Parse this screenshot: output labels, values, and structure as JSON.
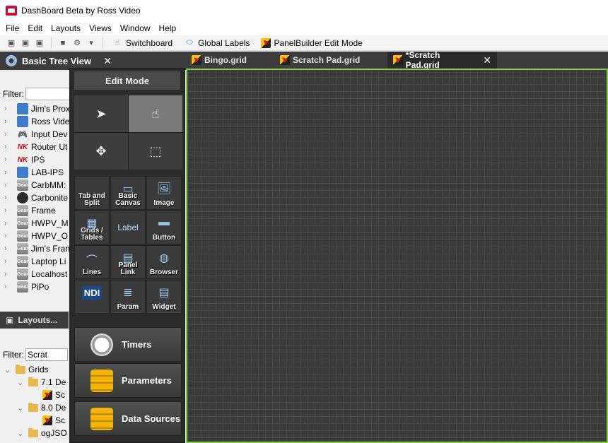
{
  "window": {
    "title": "DashBoard Beta by Ross Video"
  },
  "menu": [
    "File",
    "Edit",
    "Layouts",
    "Views",
    "Window",
    "Help"
  ],
  "toolbar": {
    "switchboard": "Switchboard",
    "global_labels": "Global Labels",
    "panelbuilder": "PanelBuilder Edit Mode"
  },
  "tree_panel": {
    "title": "Basic Tree View",
    "filter_label": "Filter:",
    "filter_value": "",
    "items": [
      {
        "label": "Jim's Prox",
        "icon": "network-icon"
      },
      {
        "label": "Ross Vide",
        "icon": "ross-icon"
      },
      {
        "label": "Input Dev",
        "icon": "gamepad-icon"
      },
      {
        "label": "Router Ut",
        "icon": "nk-icon"
      },
      {
        "label": "IPS",
        "icon": "nk-icon"
      },
      {
        "label": "LAB-IPS",
        "icon": "device-icon"
      },
      {
        "label": "CarbMM:",
        "icon": "gear-icon"
      },
      {
        "label": "Carbonite",
        "icon": "carbonite-icon"
      },
      {
        "label": "Frame",
        "icon": "gear-icon"
      },
      {
        "label": "HWPV_M",
        "icon": "gear-icon"
      },
      {
        "label": "HWPV_O",
        "icon": "gear-icon"
      },
      {
        "label": "Jim's Fran",
        "icon": "gear-icon"
      },
      {
        "label": "Laptop Li",
        "icon": "gear-icon"
      },
      {
        "label": "Localhost",
        "icon": "gear-icon"
      },
      {
        "label": "PiPo",
        "icon": "gear-icon"
      }
    ]
  },
  "layouts_panel": {
    "title": "Layouts...",
    "filter_label": "Filter:",
    "filter_value": "Scrat",
    "items": [
      {
        "label": "Grids",
        "level": 0,
        "type": "folder"
      },
      {
        "label": "7.1 De",
        "level": 1,
        "type": "folder"
      },
      {
        "label": "Sc",
        "level": 2,
        "type": "grid"
      },
      {
        "label": "8.0 De",
        "level": 1,
        "type": "folder"
      },
      {
        "label": "Sc",
        "level": 2,
        "type": "grid"
      },
      {
        "label": "ogJSO",
        "level": 1,
        "type": "folder"
      }
    ]
  },
  "palette": {
    "title": "Edit Mode",
    "components": [
      {
        "label": "Tab and Split",
        "icon": "tab-split-icon"
      },
      {
        "label": "Basic Canvas",
        "icon": "canvas-icon"
      },
      {
        "label": "Image",
        "icon": "image-icon"
      },
      {
        "label": "Grids / Tables",
        "icon": "grid-table-icon"
      },
      {
        "label": "Label",
        "icon": "label-icon"
      },
      {
        "label": "Button",
        "icon": "button-icon"
      },
      {
        "label": "Lines",
        "icon": "lines-icon"
      },
      {
        "label": "Panel Link",
        "icon": "panel-link-icon"
      },
      {
        "label": "Browser",
        "icon": "browser-icon"
      },
      {
        "label": "NDI",
        "icon": "ndi-icon"
      },
      {
        "label": "Param",
        "icon": "param-icon"
      },
      {
        "label": "Widget",
        "icon": "widget-icon"
      }
    ],
    "big_buttons": [
      "Timers",
      "Parameters",
      "Data Sources"
    ]
  },
  "tabs": [
    {
      "label": "Bingo.grid",
      "active": false
    },
    {
      "label": "Scratch Pad.grid",
      "active": false
    },
    {
      "label": "*Scratch Pad.grid",
      "active": true
    }
  ],
  "colors": {
    "canvas_border": "#7ed03b",
    "canvas_bg": "#3a3a3a"
  }
}
